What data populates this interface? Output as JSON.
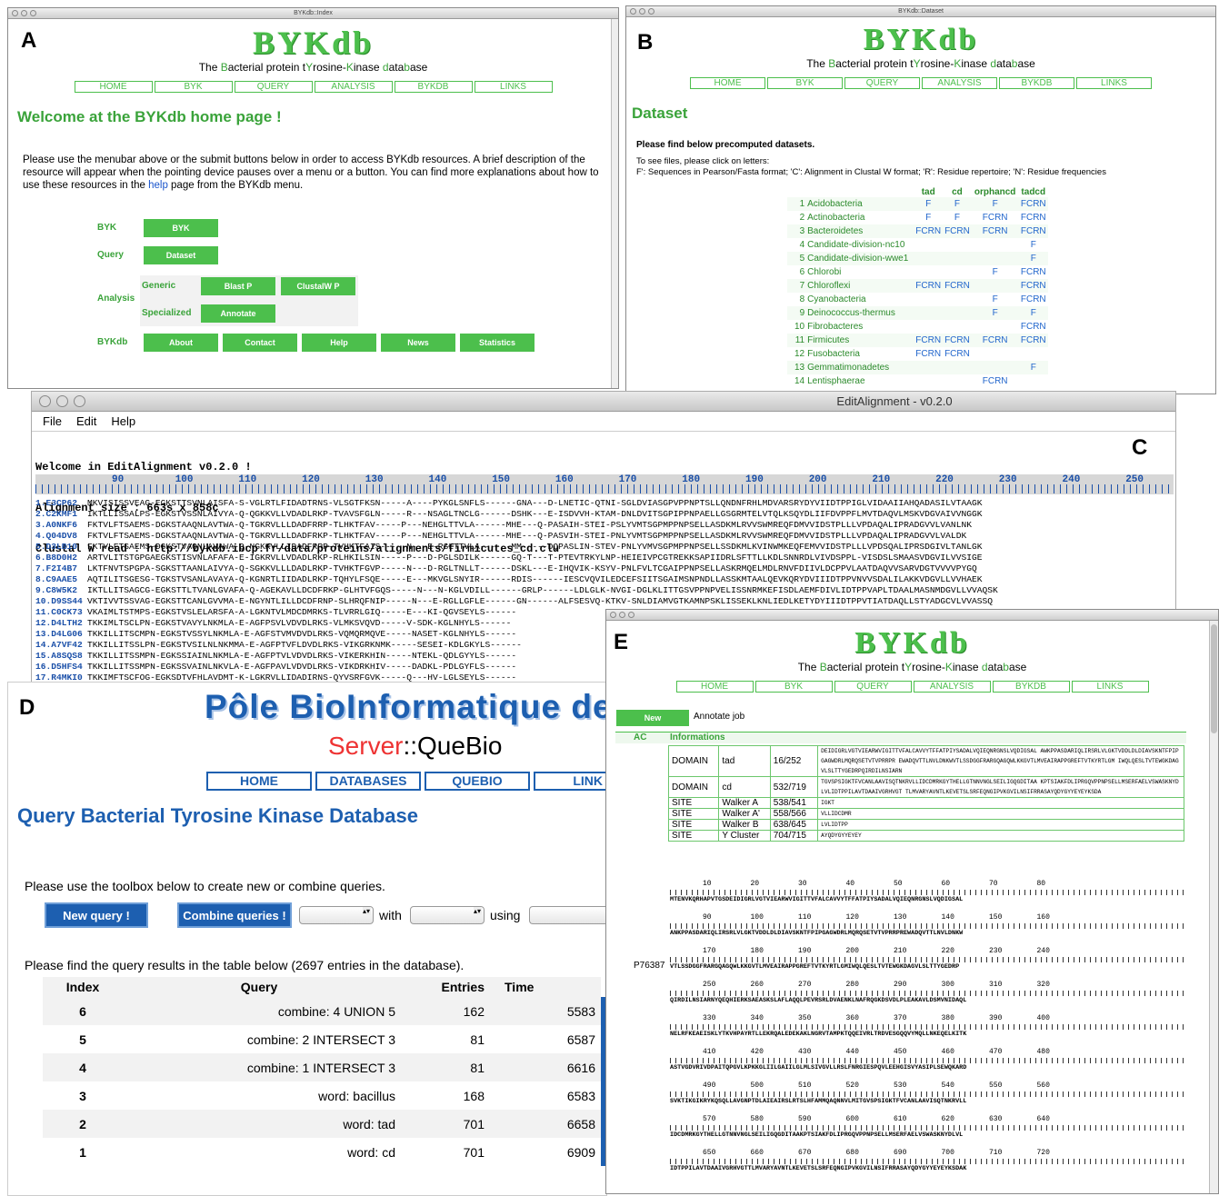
{
  "panel_labels": {
    "a": "A",
    "b": "B",
    "c": "C",
    "d": "D",
    "e": "E"
  },
  "panelA": {
    "window_title": "BYKdb::Index",
    "logo": "BYKdb",
    "subtitle_parts": [
      "The ",
      "B",
      "acterial protein t",
      "Y",
      "rosine-",
      "K",
      "inase ",
      "d",
      "ata",
      "b",
      "ase"
    ],
    "menu": [
      "HOME",
      "BYK",
      "QUERY",
      "ANALYSIS",
      "BYKDB",
      "LINKS"
    ],
    "heading": "Welcome at the BYKdb home page !",
    "intro_before_link": "Please use the menubar above or the submit buttons below in order to access BYKdb resources. A brief description of the resource will appear when the pointing device pauses over a menu or a button. You can find more explanations about how to use these resources in the ",
    "intro_link": "help",
    "intro_after_link": " page from the BYKdb menu.",
    "rows": {
      "byk": "BYK",
      "query": "Query",
      "analysis": "Analysis",
      "generic": "Generic",
      "specialized": "Specialized",
      "bykdb": "BYKdb"
    },
    "buttons": {
      "byk": "BYK",
      "dataset": "Dataset",
      "blastp": "Blast P",
      "clustalwp": "ClustalW P",
      "annotate": "Annotate",
      "about": "About",
      "contact": "Contact",
      "help": "Help",
      "news": "News",
      "statistics": "Statistics"
    }
  },
  "panelB": {
    "window_title": "BYKdb::Dataset",
    "logo": "BYKdb",
    "menu": [
      "HOME",
      "BYK",
      "QUERY",
      "ANALYSIS",
      "BYKDB",
      "LINKS"
    ],
    "heading": "Dataset",
    "intro": "Please find below precomputed datasets.",
    "hint1": "To see files, please click on letters:",
    "hint2": "F': Sequences in Pearson/Fasta format; 'C': Alignment in Clustal W format; 'R': Residue repertoire; 'N': Residue frequencies",
    "columns": [
      "tad",
      "cd",
      "orphancd",
      "tadcd"
    ],
    "rows": [
      {
        "n": "1",
        "name": "Acidobacteria",
        "tad": "F",
        "cd": "F",
        "orphancd": "F",
        "tadcd": "FCRN"
      },
      {
        "n": "2",
        "name": "Actinobacteria",
        "tad": "F",
        "cd": "F",
        "orphancd": "FCRN",
        "tadcd": "FCRN"
      },
      {
        "n": "3",
        "name": "Bacteroidetes",
        "tad": "FCRN",
        "cd": "FCRN",
        "orphancd": "FCRN",
        "tadcd": "FCRN"
      },
      {
        "n": "4",
        "name": "Candidate-division-nc10",
        "tad": "",
        "cd": "",
        "orphancd": "",
        "tadcd": "F"
      },
      {
        "n": "5",
        "name": "Candidate-division-wwe1",
        "tad": "",
        "cd": "",
        "orphancd": "",
        "tadcd": "F"
      },
      {
        "n": "6",
        "name": "Chlorobi",
        "tad": "",
        "cd": "",
        "orphancd": "F",
        "tadcd": "FCRN"
      },
      {
        "n": "7",
        "name": "Chloroflexi",
        "tad": "FCRN",
        "cd": "FCRN",
        "orphancd": "",
        "tadcd": "FCRN"
      },
      {
        "n": "8",
        "name": "Cyanobacteria",
        "tad": "",
        "cd": "",
        "orphancd": "F",
        "tadcd": "FCRN"
      },
      {
        "n": "9",
        "name": "Deinococcus-thermus",
        "tad": "",
        "cd": "",
        "orphancd": "F",
        "tadcd": "F"
      },
      {
        "n": "10",
        "name": "Fibrobacteres",
        "tad": "",
        "cd": "",
        "orphancd": "",
        "tadcd": "FCRN"
      },
      {
        "n": "11",
        "name": "Firmicutes",
        "tad": "FCRN",
        "cd": "FCRN",
        "orphancd": "FCRN",
        "tadcd": "FCRN"
      },
      {
        "n": "12",
        "name": "Fusobacteria",
        "tad": "FCRN",
        "cd": "FCRN",
        "orphancd": "",
        "tadcd": ""
      },
      {
        "n": "13",
        "name": "Gemmatimonadetes",
        "tad": "",
        "cd": "",
        "orphancd": "",
        "tadcd": "F"
      },
      {
        "n": "14",
        "name": "Lentisphaerae",
        "tad": "",
        "cd": "",
        "orphancd": "FCRN",
        "tadcd": ""
      }
    ]
  },
  "panelC": {
    "window_title": "EditAlignment - v0.2.0",
    "menu": [
      "File",
      "Edit",
      "Help"
    ],
    "console": [
      "Welcome in EditAlignment v0.2.0 !",
      "Alignment size : 663s x 858c",
      "Clustal W read : http://bykdb.ibcp.fr/data/proteins/alignments/firmicutes_cd.clu"
    ],
    "ruler": [
      "90",
      "100",
      "110",
      "120",
      "130",
      "140",
      "150",
      "160",
      "170",
      "180",
      "190",
      "200",
      "210",
      "220",
      "230",
      "240",
      "250"
    ],
    "rows": [
      {
        "id": "1.E3CP62",
        "seq": "MKVISISSVEAG-EGKSTTSVNLAISFA-S-VGLRTLFIDADTRNS-VLSGTFKSN-----A----PYKGLSNFLS------GNA---D-LNETIC-QTNI-SGLDVIASGPVPPNPTSLLQNDNFRHLMDVARSRYDYVIIDTPPIGLVIDAAIIAHQADASILVTAAGK"
      },
      {
        "id": "2.C2KMF1",
        "seq": "IKTLLISSALPS-EGKSTVSSNLAIVYA-Q-QGKKVLLVDADLRKP-TVAVSFGLN-----R---NSAGLTNCLG------DSHK---E-ISDVVH-KTAM-DNLDVITSGPIPPNPAELLGSGRMTELVTQLKSQYDLIIFDVPPFLMVTDAQVLMSKVDGVAIVVNGGK"
      },
      {
        "id": "3.A0NKF6",
        "seq": "FKTVLFTSAEMS-DGKSTAAQNLAVTWA-Q-TGKRVLLLDADFRRP-TLHKTFAV-----P---NEHGLTTVLA------MHE---Q-PASAIH-STEI-PSLYVMTSGPMPPNPSELLASDKMLRVVSWMREQFDMVVIDSTPLLLVPDAQALIPRADGVVLVANLNK"
      },
      {
        "id": "4.Q04DV8",
        "seq": "FKTVLFTSAEMS-DGKSTAAQNLAVTWA-Q-TGKRVLLLDADFRKP-TLHKTFAV-----P---NEHGLTTVLA------MHE---Q-PASVIH-STEI-PNLYVMTSGPMPPNPSELLASDKMLRVVSWMREQFDMVVIDSTPLLLVPDAQALIPRADGVVLVALDK"
      },
      {
        "id": "5.D3LB10",
        "seq": "FKTVLFTSAEMS-DGKSTVAQNLAVAWA-Q-NGKKVLLIDADFRRP-TVHKTFAIS-----N---E-RGLTTVLA------MM-----DQPASLIN-STEV-PNLYVMVSGPMPPNPSELLSSDKMLKVINWMKEQFEMVVIDSTPLLLVPDSQALIPRSDGIVLTANLGK"
      },
      {
        "id": "6.B8D0H2",
        "seq": "ARTVLITSTGPGAEGKSTISVNLAFAFA-E-IGKRVLLVDADLRKP-RLHKILSIN-----P---D-PGLSDILK------GQ-T---T-PTEVTRKYLNP-HEIEIVPCGTREKKSAPIIDRLSFTTLLKDLSNNRDLVIVDSPPL-VISDSLSMAASVDGVILVVSIGE"
      },
      {
        "id": "7.F2I4B7",
        "seq": "LKTFNVTSPGPA-SGKSTTAANLAIVYA-Q-SGKKVLLLDADLRKP-TVHKTFGVP-----N---D-RGLTNLLT------DSKL---E-IHQVIK-KSYV-PNLFVLTCGAIPPNPSELLASKRMQELMDLRNVFDIIVLDCPPVLAATDAQVVSARVDGTVVVVPYGQ"
      },
      {
        "id": "8.C9AAE5",
        "seq": "AQTILITSGESG-TGKSTVSANLAVAYA-Q-KGNRTLIIDADLRKP-TQHYLFSQE-----E---MKVGLSNYIR------RDIS------IESCVQVILEDCEFSIITSGAIMSNPNDLLASSKMTAALQEVKQRYDVIIIDTPPVNVVSDALILAKKVDGVLLVVHAEK"
      },
      {
        "id": "9.C8W5K2",
        "seq": "IKTLLITSAGCG-EGKSTTLTVANLGVAFA-Q-AGEKAVLLDCDFRKP-GLHTVFGQS-----N---N-KGLVDILL------GRLP------LDLGLK-NVGI-DGLKLITTGSVPPNPVELISSNRMKEFISDLAEMFDIVLIDTPPVAPLTDAALMASNMDGVLLVVAQSK"
      },
      {
        "id": "10.D9SS44",
        "seq": "VKTIVVTSSVAG-EGKSTTCANLGVVMA-E-NGYNTLILLDCDFRNP-SLHRQFNIP-----N---E-RGLLGFLE------GN------ALFSESVQ-KTKV-SNLDIAMVGTKAMNPSKLISSEKLKNLIEDLKETYDYIIIDTPPVTIATDAQLLSTYADGCVLVVASSQ"
      },
      {
        "id": "11.C0CK73",
        "seq": "VKAIMLTSTMPS-EGKSTVSLELARSFA-A-LGKNTVLMDCDMRKS-TLVRRLGIQ-----E---KI-QGVSEYLS------"
      },
      {
        "id": "12.D4LTH2",
        "seq": "TKKIMLTSCLPN-EGKSTVAVYLNKMLA-E-AGFPSVLVDVDLRKS-VLMKSVQVD-----V-SDK-KGLNHYLS------"
      },
      {
        "id": "13.D4LG06",
        "seq": "TKKILLITSCMPN-EGKSTVSSYLNKMLA-E-AGFSTVMVDVDLRKS-VQMQRMQVE-----NASET-KGLNHYLS------"
      },
      {
        "id": "14.A7VF42",
        "seq": "TKKILLITSSLPN-EGKSTVSILNLNKMMA-E-AGFPTVFLDVDLRKS-VIKGRKNMK-----SESEI-KDLGKYLS------"
      },
      {
        "id": "15.A8SQS8",
        "seq": "TKKILLITSSMPN-EGKSSIAINLNKMLA-E-AGFPTVLVDVDLRKS-VIKERKHIN-----NTEKL-QDLGYYLS------"
      },
      {
        "id": "16.D5HFS4",
        "seq": "TKKILLITSSMPN-EGKSSVAINLNKVLA-E-AGFPAVLVDVDLRKS-VIKDRKHIV-----DADKL-PDLGYFLS------"
      },
      {
        "id": "17.R4MKI0",
        "seq": "TKKIMFTSCFOG-EGKSDTVFHLAVDMT-K-LGKRVLLIDADIRNS-QYVSRFGVK-----Q---HV-LGLSEYLS------"
      }
    ]
  },
  "panelD": {
    "banner": "Pôle BioInformatique de Ly",
    "server_prefix": "Server",
    "server_name": "::QueBio",
    "menu": [
      "HOME",
      "DATABASES",
      "QUEBIO",
      "LINK"
    ],
    "heading": "Query Bacterial Tyrosine Kinase Database",
    "toolbox_text": "Please use the toolbox below to create new or combine queries.",
    "new_query": "New query !",
    "combine_queries": "Combine queries !",
    "with": "with",
    "using": "using",
    "results_text": "Please find the query results in the table below (2697 entries in the database).",
    "columns": [
      "Index",
      "Query",
      "Entries",
      "Time"
    ],
    "rows": [
      {
        "index": "6",
        "query": "combine: 4 UNION 5",
        "entries": "162",
        "time": "5583"
      },
      {
        "index": "5",
        "query": "combine: 2 INTERSECT 3",
        "entries": "81",
        "time": "6587"
      },
      {
        "index": "4",
        "query": "combine: 1 INTERSECT 3",
        "entries": "81",
        "time": "6616"
      },
      {
        "index": "3",
        "query": "word: bacillus",
        "entries": "168",
        "time": "6583"
      },
      {
        "index": "2",
        "query": "word: tad",
        "entries": "701",
        "time": "6658"
      },
      {
        "index": "1",
        "query": "word: cd",
        "entries": "701",
        "time": "6909"
      }
    ]
  },
  "panelE": {
    "logo": "BYKdb",
    "menu": [
      "HOME",
      "BYK",
      "QUERY",
      "ANALYSIS",
      "BYKDB",
      "LINKS"
    ],
    "new_button": "New",
    "job_label": "Annotate job",
    "ac_header": "AC",
    "info_header": "Informations",
    "accession": "P76387",
    "features": [
      {
        "type": "DOMAIN",
        "name": "tad",
        "range": "16/252",
        "seq": "DEIDIGRLVGTVIEARWVIGITTVFALCAVVYTFFATPIYSADALVQIEQNRGNSLVQDIGSAL AWKPPASDARIQLIRSRLVLGKTVDDLDLDIAVSKNTFPIPGAGWDRLMQRQSETVTVPRRPR EWADQVTTLNVLDNKWVTLSSDGGFRARGQAGQWLKKGVTLMVEAIRAPPGREFTVTKYRTLGM IWQLQESLTVTEWGKDAGVLSLTTYGEDRPQIRDILNSIARN"
      },
      {
        "type": "DOMAIN",
        "name": "cd",
        "range": "532/719",
        "seq": "TGVSPSIGKTFVCANLAAVISQTNKRVLLIDCDMRKGYTHELLGTNNVNGLSEILIGQGDITAA KPTSIAKFDLIPRGQVPPNPSELLMSERFAELVSWASKNYDLVLIDTPPILAVTDAAIVGRHVGT TLMVARYAVNTLKEVETSLSRFEQNGIPVKGVILNSIFRRASAYQDYGYYEYEYKSDA"
      },
      {
        "type": "SITE",
        "name": "Walker A",
        "range": "538/541",
        "seq": "IGKT"
      },
      {
        "type": "SITE",
        "name": "Walker A'",
        "range": "558/566",
        "seq": "VLLIDCDMR"
      },
      {
        "type": "SITE",
        "name": "Walker B",
        "range": "638/645",
        "seq": "LVLIDTPP"
      },
      {
        "type": "SITE",
        "name": "Y Cluster",
        "range": "704/715",
        "seq": "AYQDYGYYEYEY"
      }
    ],
    "sequence_blocks": [
      {
        "ruler": [
          "10",
          "20",
          "30",
          "40",
          "50",
          "60",
          "70",
          "80"
        ],
        "seq": "MTENVKQRHAPVTGSDEIDIGRLVGTVIEARWVIGITTVFALCAVVYTFFATPIYSADALVQIEQNRGNSLVQDIGSAL"
      },
      {
        "ruler": [
          "90",
          "100",
          "110",
          "120",
          "130",
          "140",
          "150",
          "160"
        ],
        "seq": "ANKPPASDARIQLIRSRLVLGKTVDDLDLDIAVSKNTFPIPGAGWDRLMQRQSETVTVPRRPREWADQVTTLNVLDNKW"
      },
      {
        "ruler": [
          "170",
          "180",
          "190",
          "200",
          "210",
          "220",
          "230",
          "240"
        ],
        "seq": "VTLSSDGGFRARGQAGQWLKKGVTLMVEAIRAPPGREFTVTKYRTLGMIWQLQESLTVTEWGKDAGVLSLTTYGEDRP"
      },
      {
        "ruler": [
          "250",
          "260",
          "270",
          "280",
          "290",
          "300",
          "310",
          "320"
        ],
        "seq": "QIRDILNSIARNYQEQHIERKSAEASKSLAFLAQQLPEVRSRLDVAENKLNAFRQGKDSVDLPLEAKAVLDSMVNIDAQL"
      },
      {
        "ruler": [
          "330",
          "340",
          "350",
          "360",
          "370",
          "380",
          "390",
          "400"
        ],
        "seq": "NELRFKEAEISKLYTKVHPAYRTLLEKRQALEDEKAKLNGRVTAMPKTQQEIVRLTRDVESGQQVYMQLLNKEQELKITK"
      },
      {
        "ruler": [
          "410",
          "420",
          "430",
          "440",
          "450",
          "460",
          "470",
          "480"
        ],
        "seq": "ASTVGDVRIVDPAITQPGVLKPKKGLIILGAIILGLMLSIVGVLLRSLFNRGIESPQVLEEHGISVYASIPLSEWQKARD"
      },
      {
        "ruler": [
          "490",
          "500",
          "510",
          "520",
          "530",
          "540",
          "550",
          "560"
        ],
        "seq": "SVKTIKGIKRYKQSQLLAVGNPTDLAIEAIRSLRTSLHFAMMQAQNNVLMITGVSPSIGKTFVCANLAAVISQTNKRVLL"
      },
      {
        "ruler": [
          "570",
          "580",
          "590",
          "600",
          "610",
          "620",
          "630",
          "640"
        ],
        "seq": "IDCDMRKGYTHELLGTNNVNGLSEILIGQGDITAAKPTSIAKFDLIPRGQVPPNPSELLMSERFAELVSWASKNYDLVL"
      },
      {
        "ruler": [
          "650",
          "660",
          "670",
          "680",
          "690",
          "700",
          "710",
          "720"
        ],
        "seq": "IDTPPILAVTDAAIVGRHVGTTLMVARYAVNTLKEVETSLSRFEQNGIPVKGVILNSIFRRASAYQDYGYYEYEYKSDAK"
      }
    ]
  }
}
